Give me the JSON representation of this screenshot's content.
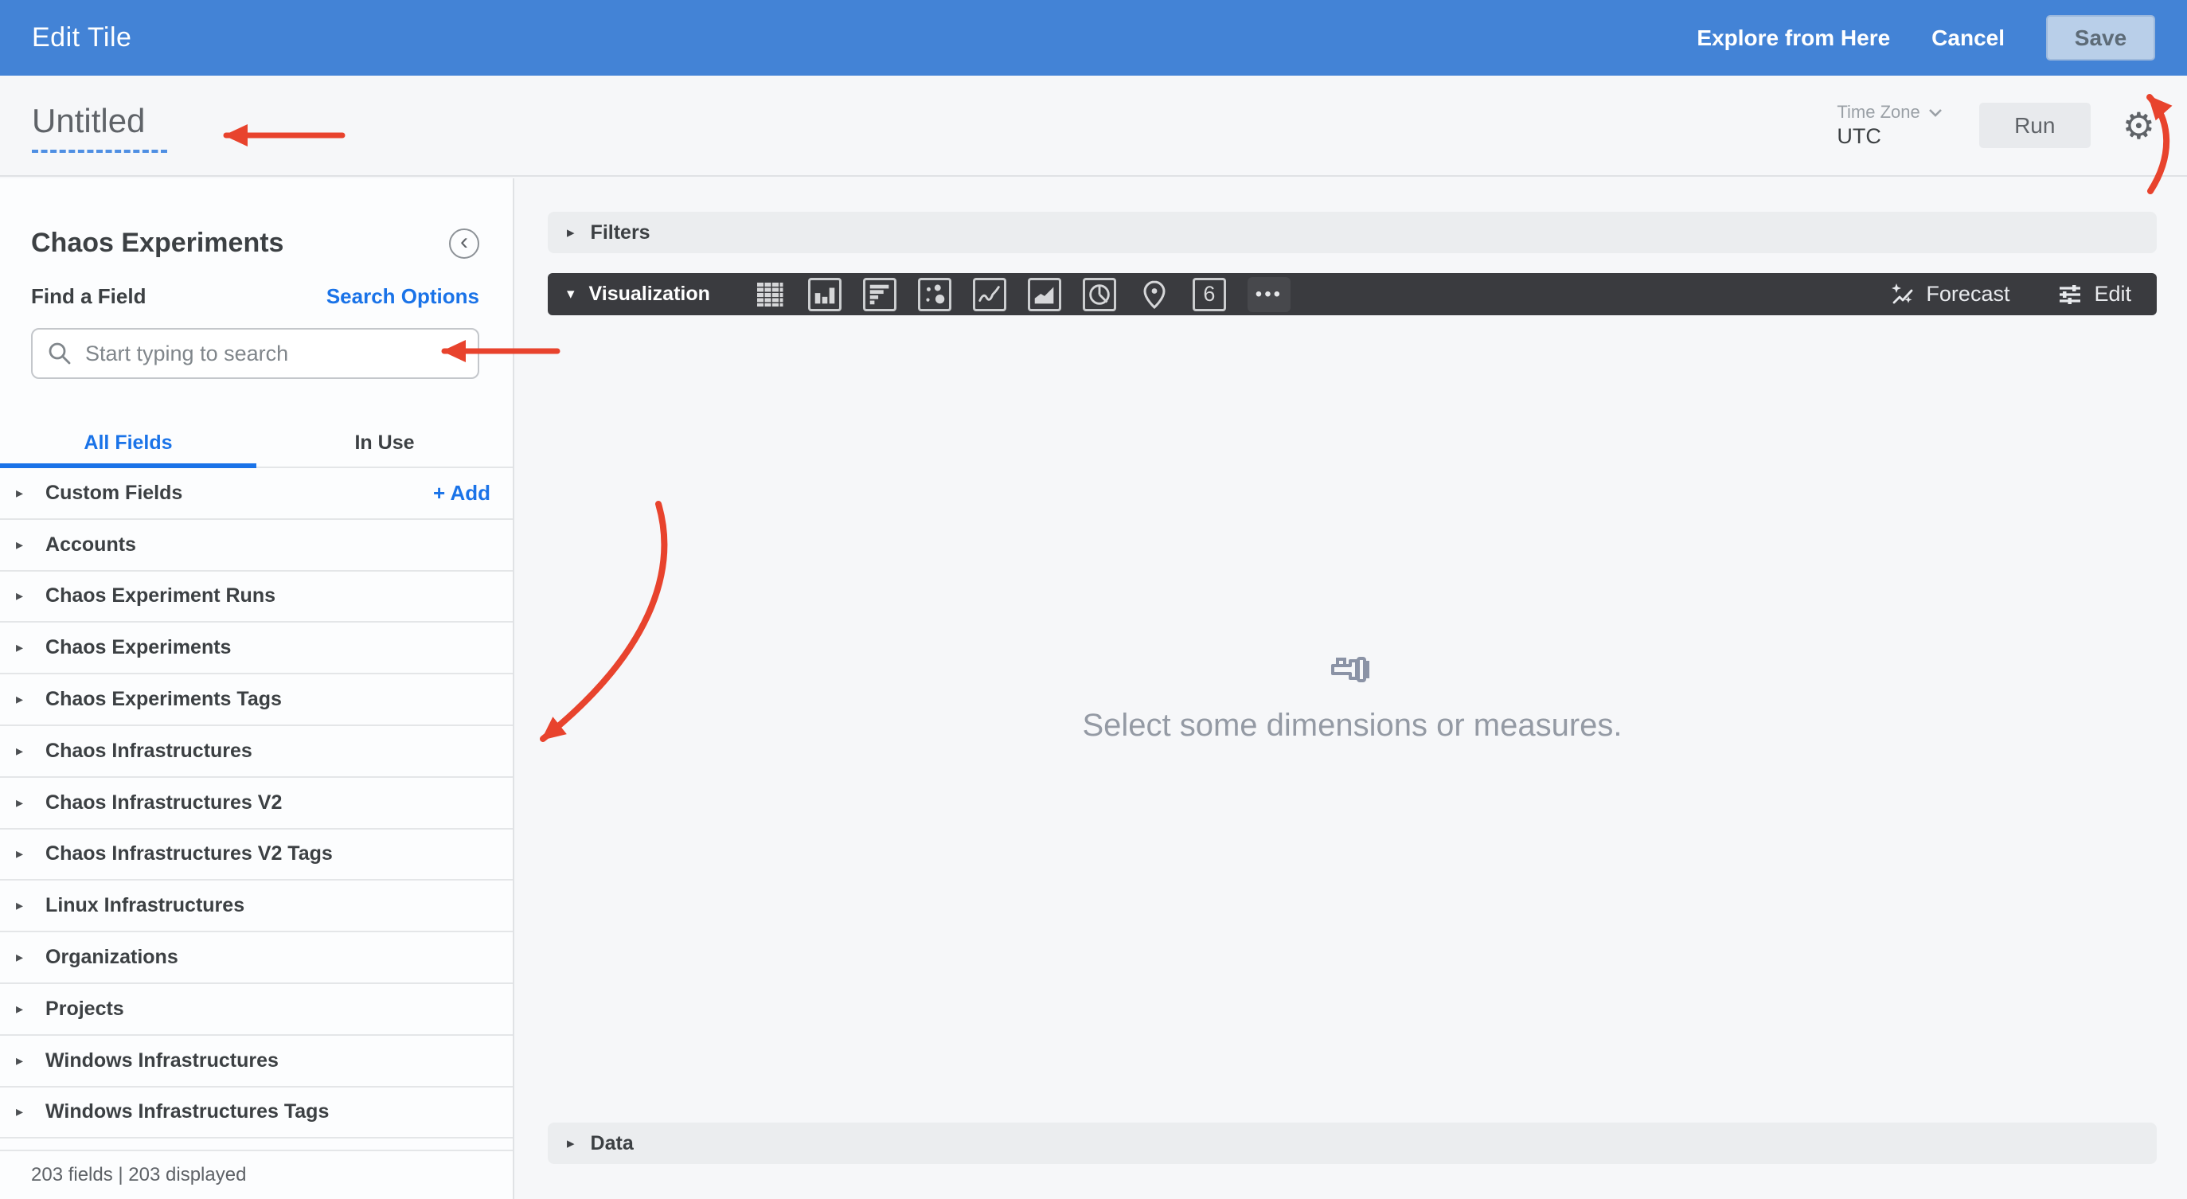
{
  "top_bar": {
    "title": "Edit Tile",
    "explore_label": "Explore from Here",
    "cancel_label": "Cancel",
    "save_label": "Save"
  },
  "header": {
    "title": "Untitled",
    "timezone_label": "Time Zone",
    "timezone_value": "UTC",
    "run_label": "Run"
  },
  "sidebar": {
    "title": "Chaos Experiments",
    "find_label": "Find a Field",
    "search_options_label": "Search Options",
    "search_placeholder": "Start typing to search",
    "tabs": [
      {
        "label": "All Fields",
        "active": true
      },
      {
        "label": "In Use",
        "active": false
      }
    ],
    "add_label": "+  Add",
    "fields": [
      {
        "label": "Custom Fields",
        "has_add": true
      },
      {
        "label": "Accounts"
      },
      {
        "label": "Chaos Experiment Runs"
      },
      {
        "label": "Chaos Experiments"
      },
      {
        "label": "Chaos Experiments Tags"
      },
      {
        "label": "Chaos Infrastructures"
      },
      {
        "label": "Chaos Infrastructures V2"
      },
      {
        "label": "Chaos Infrastructures V2 Tags"
      },
      {
        "label": "Linux Infrastructures"
      },
      {
        "label": "Organizations"
      },
      {
        "label": "Projects"
      },
      {
        "label": "Windows Infrastructures"
      },
      {
        "label": "Windows Infrastructures Tags"
      }
    ],
    "footer": "203 fields | 203 displayed"
  },
  "main": {
    "filters_label": "Filters",
    "visualization_label": "Visualization",
    "viz_icon_names": [
      "table",
      "column",
      "bar",
      "scatterplot",
      "line",
      "area",
      "pie",
      "map",
      "single-value",
      "more"
    ],
    "single_value_glyph": "6",
    "forecast_label": "Forecast",
    "edit_label": "Edit",
    "empty_state_text": "Select some dimensions or measures.",
    "data_label": "Data"
  },
  "icons": {
    "caret_right": "▸",
    "caret_down": "▾",
    "chevron_left": "‹",
    "gear": "⚙",
    "more": "•••"
  },
  "colors": {
    "top_bar_blue": "#4383d6",
    "accent_blue": "#1a73e8",
    "dark_bar": "#3a3b3f",
    "annotation_red": "#e8432d"
  }
}
